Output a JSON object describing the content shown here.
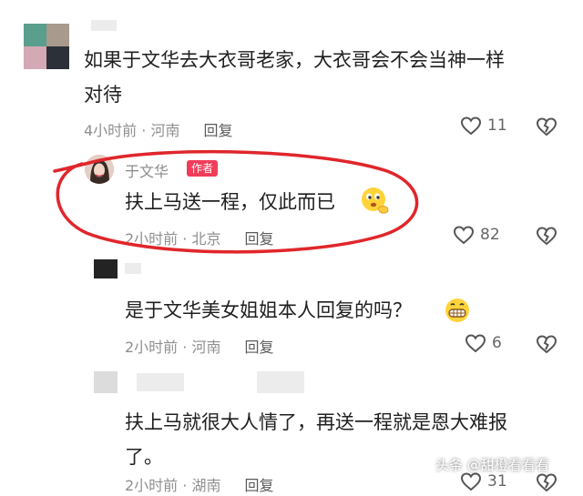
{
  "comments": [
    {
      "text_lines": [
        "如果于文华去大衣哥老家，大衣哥会不会当神一样",
        "对待"
      ],
      "time": "4小时前",
      "location": "河南",
      "reply_label": "回复",
      "likes": "11"
    },
    {
      "author": "于文华",
      "author_tag": "作者",
      "text": "扶上马送一程，仅此而已",
      "time": "2小时前",
      "location": "北京",
      "reply_label": "回复",
      "likes": "82"
    },
    {
      "text": "是于文华美女姐姐本人回复的吗？",
      "time": "2小时前",
      "location": "河南",
      "reply_label": "回复",
      "likes": "6"
    },
    {
      "text_lines": [
        "扶上马就很大人情了，再送一程就是恩大难报",
        "了。"
      ],
      "time": "2小时前",
      "location": "湖南",
      "reply_label": "回复",
      "likes": "31"
    }
  ],
  "watermark": "头条 @甜橙看看看",
  "colors": {
    "annotation_red": "#e0262b",
    "author_tag_bg": "#f03d5a"
  },
  "icons": [
    "heart-icon",
    "broken-heart-icon",
    "thinking-face-emoji",
    "grinning-face-emoji"
  ]
}
